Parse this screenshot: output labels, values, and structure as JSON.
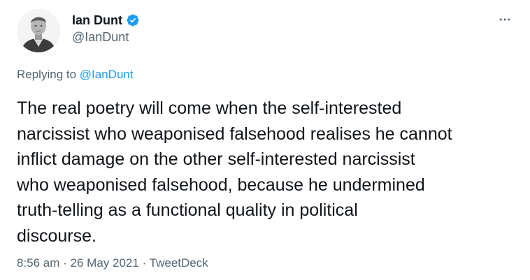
{
  "author": {
    "display_name": "Ian Dunt",
    "handle": "@IanDunt",
    "verified": true
  },
  "menu": {
    "icon": "more-horizontal-icon"
  },
  "reply_context": {
    "prefix": "Replying to ",
    "mention": "@IanDunt"
  },
  "tweet": {
    "text": "The real poetry will come when the self-interested\nnarcissist who weaponised falsehood realises he cannot\ninflict damage on the other self-interested narcissist\nwho weaponised falsehood, because he undermined\ntruth-telling as a functional quality in political\ndiscourse."
  },
  "meta": {
    "time": "8:56 am",
    "separator": " · ",
    "date": "26 May 2021",
    "source": "TweetDeck"
  },
  "colors": {
    "link": "#1d9bf0",
    "secondary_text": "#536471",
    "primary_text": "#0f1419",
    "verified_badge": "#1d9bf0"
  }
}
